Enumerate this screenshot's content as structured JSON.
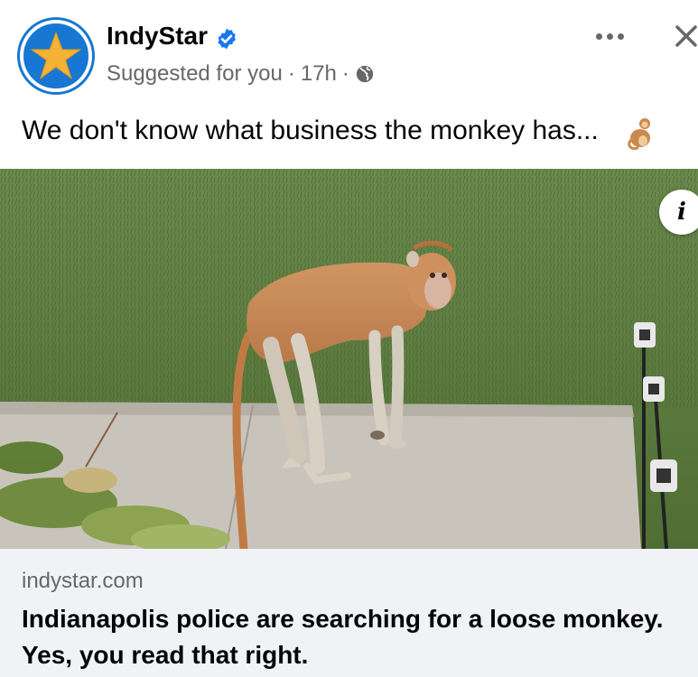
{
  "post": {
    "page_name": "IndyStar",
    "verified": true,
    "suggestion_label": "Suggested for you",
    "separator": "·",
    "time": "17h",
    "audience_icon": "globe-icon",
    "caption": "We don't know what business the monkey has...",
    "caption_emoji": "monkey-emoji"
  },
  "actions": {
    "more_icon": "more-options-icon",
    "close_icon": "close-icon"
  },
  "media": {
    "description_icon": "info-icon",
    "info_label": "i"
  },
  "link": {
    "domain": "indystar.com",
    "title": "Indianapolis police are searching for a loose monkey. Yes, you read that right."
  },
  "colors": {
    "brand_blue": "#1877d2",
    "secondary_text": "#65676b",
    "link_panel_bg": "#f0f2f5",
    "verified_blue": "#1877f2"
  }
}
